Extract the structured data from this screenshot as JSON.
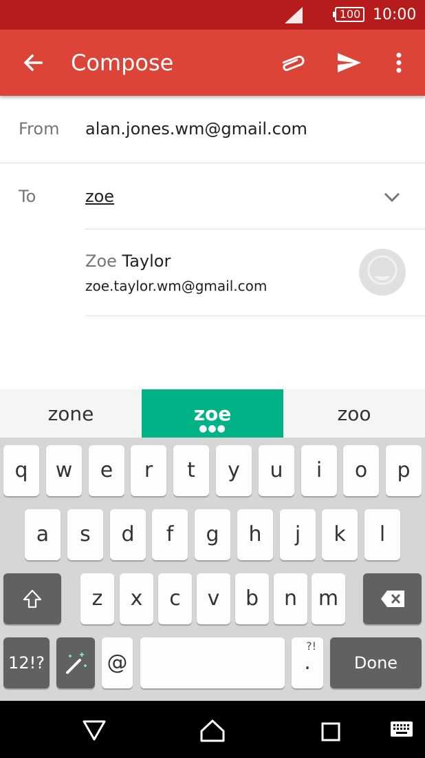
{
  "status_bar": {
    "battery": "100",
    "time": "10:00",
    "icons": [
      "signal-icon",
      "battery-icon"
    ]
  },
  "app_bar": {
    "title": "Compose",
    "icons": [
      "back-arrow-icon",
      "attach-icon",
      "send-icon",
      "more-vert-icon"
    ]
  },
  "form": {
    "from_label": "From",
    "from_value": "alan.jones.wm@gmail.com",
    "to_label": "To",
    "to_value": "zoe"
  },
  "suggestion": {
    "name_match": "Zoe",
    "name_rest": " Taylor",
    "email": "zoe.taylor.wm@gmail.com"
  },
  "word_suggestions": [
    "zone",
    "zoe",
    "zoo"
  ],
  "keyboard": {
    "row1": [
      "q",
      "w",
      "e",
      "r",
      "t",
      "y",
      "u",
      "i",
      "o",
      "p"
    ],
    "row2": [
      "a",
      "s",
      "d",
      "f",
      "g",
      "h",
      "j",
      "k",
      "l"
    ],
    "row3": [
      "z",
      "x",
      "c",
      "v",
      "b",
      "n",
      "m"
    ],
    "symbols_key": "12!?",
    "at_key": "@",
    "period_key": ".",
    "period_sub": "?!",
    "done_key": "Done"
  },
  "colors": {
    "status_bar": "#b71c1c",
    "app_bar": "#db4437",
    "suggestion_highlight": "#00b386"
  }
}
